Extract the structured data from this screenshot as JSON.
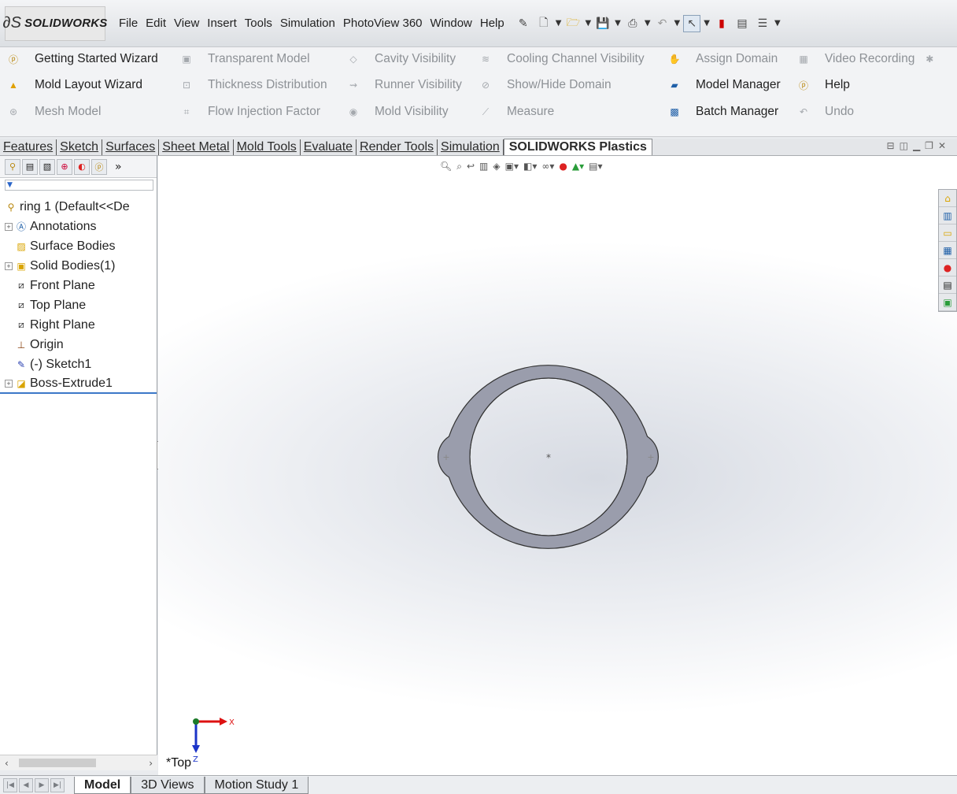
{
  "app": {
    "logo_text": "SOLIDWORKS",
    "menu": [
      "File",
      "Edit",
      "View",
      "Insert",
      "Tools",
      "Simulation",
      "PhotoView 360",
      "Window",
      "Help"
    ]
  },
  "command_manager": {
    "col1": [
      "Getting Started Wizard",
      "Mold Layout Wizard",
      "Mesh Model"
    ],
    "col2": [
      "Transparent Model",
      "Thickness Distribution",
      "Flow Injection Factor"
    ],
    "col3": [
      "Cavity Visibility",
      "Runner Visibility",
      "Mold Visibility"
    ],
    "col4": [
      "Cooling Channel Visibility",
      "Show/Hide Domain",
      "Measure"
    ],
    "col5": [
      "Assign Domain",
      "Model Manager",
      "Batch Manager"
    ],
    "col6": [
      "Video Recording",
      "Help",
      "Undo"
    ]
  },
  "tabs": [
    "Features",
    "Sketch",
    "Surfaces",
    "Sheet Metal",
    "Mold Tools",
    "Evaluate",
    "Render Tools",
    "Simulation",
    "SOLIDWORKS Plastics"
  ],
  "tree": {
    "root": "ring 1  (Default<<De",
    "items": [
      "Annotations",
      "Surface Bodies",
      "Solid Bodies(1)",
      "Front Plane",
      "Top Plane",
      "Right Plane",
      "Origin",
      "(-) Sketch1",
      "Boss-Extrude1"
    ],
    "filter_icon": "filter-icon"
  },
  "viewport": {
    "view_name": "*Top",
    "triad_x": "X",
    "triad_z": "Z",
    "model_fill": "#9a9dac"
  },
  "bottom_tabs": [
    "Model",
    "3D Views",
    "Motion Study 1"
  ],
  "colors": {
    "accent": "#3c78c8",
    "model": "#9a9dac"
  }
}
